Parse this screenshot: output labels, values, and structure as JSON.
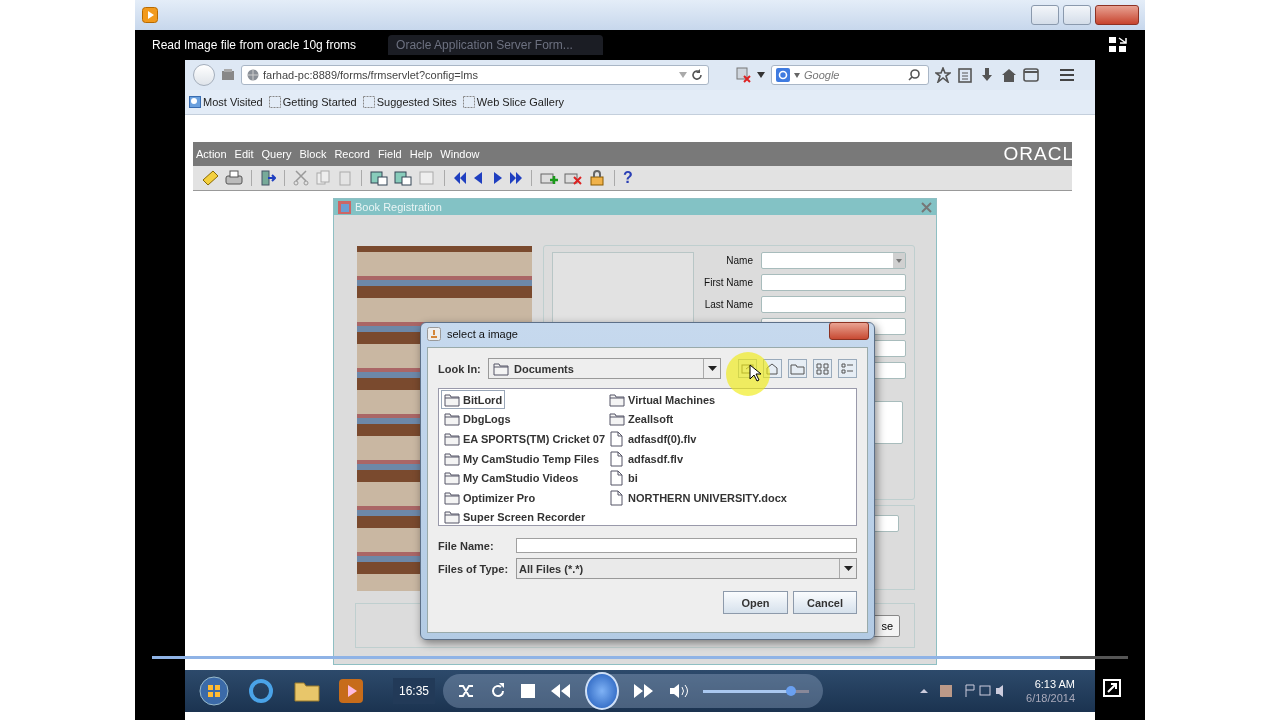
{
  "video_window": {
    "tabs": [
      {
        "label": "Read Image file from oracle 10g froms",
        "selected": true
      },
      {
        "label": "Oracle Application Server Form...",
        "selected": false
      }
    ]
  },
  "browser": {
    "address": "farhad-pc:8889/forms/frmservlet?config=lms",
    "search": {
      "placeholder": "Google"
    },
    "bookmarks": [
      "Most Visited",
      "Getting Started",
      "Suggested Sites",
      "Web Slice Gallery"
    ]
  },
  "forms": {
    "menu": [
      "Action",
      "Edit",
      "Query",
      "Block",
      "Record",
      "Field",
      "Help",
      "Window"
    ],
    "logo": "ORACL",
    "help_glyph": "?",
    "window": {
      "title": "Book Registration",
      "fields": [
        {
          "label": "Name",
          "kind": "dropdown"
        },
        {
          "label": "First Name",
          "kind": "text"
        },
        {
          "label": "Last Name",
          "kind": "text"
        }
      ],
      "button": "se"
    }
  },
  "dialog": {
    "title": "select a image",
    "look_in": {
      "label": "Look In:",
      "value": "Documents"
    },
    "files": [
      {
        "name": "BitLord",
        "kind": "folder",
        "selected": true
      },
      {
        "name": "DbgLogs",
        "kind": "folder",
        "selected": false
      },
      {
        "name": "EA SPORTS(TM) Cricket 07",
        "kind": "folder",
        "selected": false
      },
      {
        "name": "My CamStudio Temp Files",
        "kind": "folder",
        "selected": false
      },
      {
        "name": "My CamStudio Videos",
        "kind": "folder",
        "selected": false
      },
      {
        "name": "Optimizer Pro",
        "kind": "folder",
        "selected": false
      },
      {
        "name": "Super Screen Recorder",
        "kind": "folder",
        "selected": false
      },
      {
        "name": "Virtual Machines",
        "kind": "folder",
        "selected": false
      },
      {
        "name": "Zeallsoft",
        "kind": "folder",
        "selected": false
      },
      {
        "name": "adfasdf(0).flv",
        "kind": "file",
        "selected": false
      },
      {
        "name": "adfasdf.flv",
        "kind": "file",
        "selected": false
      },
      {
        "name": "bi",
        "kind": "file",
        "selected": false
      },
      {
        "name": "NORTHERN UNIVERSITY.docx",
        "kind": "file",
        "selected": false
      }
    ],
    "file_name": {
      "label": "File Name:"
    },
    "file_type": {
      "label": "Files of Type:",
      "value": "All Files (*.*)"
    },
    "buttons": [
      "Open",
      "Cancel"
    ]
  },
  "player": {
    "seek": {
      "level": 0.93
    },
    "elapsed": "16:35",
    "volume": {
      "level": 0.83
    }
  },
  "taskbar": {
    "time": "6:13 AM",
    "date": "6/18/2014"
  }
}
